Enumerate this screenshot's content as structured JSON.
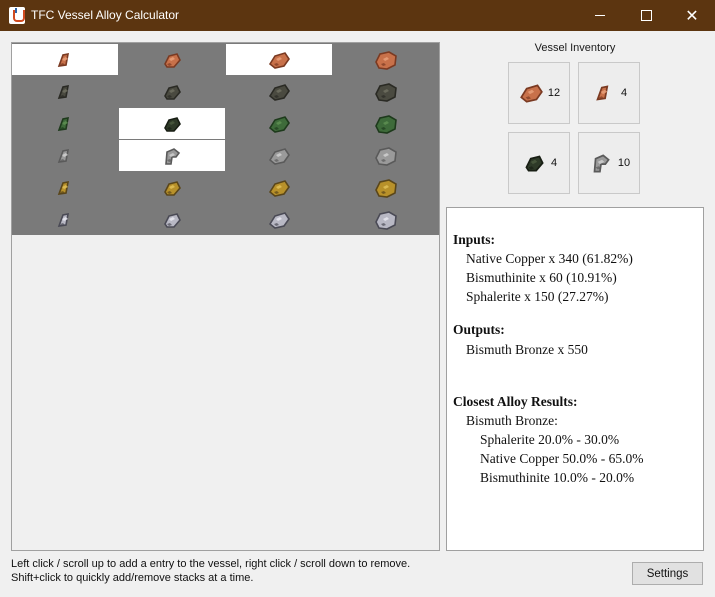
{
  "window": {
    "title": "TFC Vessel Alloy Calculator",
    "app_icon": "java-cup-icon",
    "controls": [
      "minimize-icon",
      "maximize-icon",
      "close-icon"
    ],
    "close_glyph": "✕"
  },
  "ore_grid": {
    "columns": 4,
    "rows": [
      [
        {
          "icon": "native-copper-ore-small-icon",
          "selected": true
        },
        {
          "icon": "native-copper-ore-poor-icon",
          "selected": false
        },
        {
          "icon": "native-copper-ore-normal-icon",
          "selected": true
        },
        {
          "icon": "native-copper-ore-rich-icon",
          "selected": false
        }
      ],
      [
        {
          "icon": "bismuthinite-ore-small-icon",
          "selected": false
        },
        {
          "icon": "bismuthinite-ore-poor-icon",
          "selected": false
        },
        {
          "icon": "bismuthinite-ore-normal-icon",
          "selected": false
        },
        {
          "icon": "bismuthinite-ore-rich-icon",
          "selected": false
        }
      ],
      [
        {
          "icon": "malachite-ore-small-icon",
          "selected": false
        },
        {
          "icon": "sphalerite-ore-poor-icon",
          "selected": true
        },
        {
          "icon": "malachite-ore-normal-icon",
          "selected": false
        },
        {
          "icon": "malachite-ore-rich-icon",
          "selected": false
        }
      ],
      [
        {
          "icon": "cassiterite-ore-small-icon",
          "selected": false
        },
        {
          "icon": "bismuthinite-ore-gray-icon",
          "selected": true
        },
        {
          "icon": "cassiterite-ore-normal-icon",
          "selected": false
        },
        {
          "icon": "cassiterite-ore-rich-icon",
          "selected": false
        }
      ],
      [
        {
          "icon": "native-gold-ore-small-icon",
          "selected": false
        },
        {
          "icon": "native-gold-ore-poor-icon",
          "selected": false
        },
        {
          "icon": "native-gold-ore-normal-icon",
          "selected": false
        },
        {
          "icon": "native-gold-ore-rich-icon",
          "selected": false
        }
      ],
      [
        {
          "icon": "native-silver-ore-small-icon",
          "selected": false
        },
        {
          "icon": "native-silver-ore-poor-icon",
          "selected": false
        },
        {
          "icon": "native-silver-ore-normal-icon",
          "selected": false
        },
        {
          "icon": "native-silver-ore-rich-icon",
          "selected": false
        }
      ]
    ]
  },
  "inventory": {
    "title": "Vessel Inventory",
    "slots": [
      {
        "icon": "native-copper-ore-normal-icon",
        "count": "12"
      },
      {
        "icon": "native-copper-ore-small-icon",
        "count": "4"
      },
      {
        "icon": "sphalerite-ore-poor-icon",
        "count": "4"
      },
      {
        "icon": "bismuthinite-ore-gray-icon",
        "count": "10"
      }
    ]
  },
  "results": {
    "inputs_label": "Inputs:",
    "inputs": [
      "Native Copper x 340 (61.82%)",
      "Bismuthinite x 60 (10.91%)",
      "Sphalerite x 150 (27.27%)"
    ],
    "outputs_label": "Outputs:",
    "outputs": [
      "Bismuth Bronze x 550"
    ],
    "closest_label": "Closest Alloy Results:",
    "alloy_name": "Bismuth Bronze:",
    "alloy_ranges": [
      "Sphalerite 20.0% - 30.0%",
      "Native Copper 50.0% - 65.0%",
      "Bismuthinite 10.0% - 20.0%"
    ]
  },
  "help": {
    "line1": "Left click / scroll up to add a entry to the vessel, right click / scroll down to remove.",
    "line2": "Shift+click to quickly add/remove stacks at a time."
  },
  "settings_label": "Settings",
  "colors": {
    "titlebar": "#5c3510",
    "grid_background": "#7a7a7a",
    "copper": "#c8714a",
    "bismuthinite": "#4a4a40",
    "malachite": "#3e6b3a",
    "cassiterite": "#9a9a9a",
    "gold": "#b8912a",
    "silver": "#b8b8c4"
  }
}
